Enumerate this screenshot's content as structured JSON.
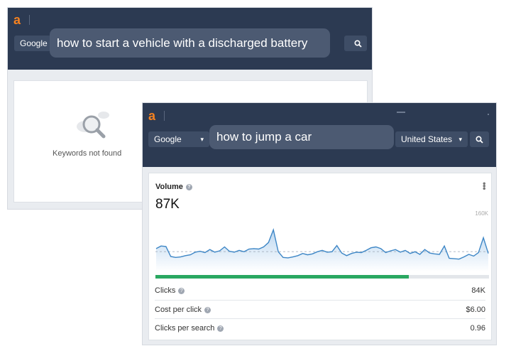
{
  "back_window": {
    "logo": "a",
    "engine": "Google",
    "query": "how to start a vehicle with a discharged battery",
    "empty_message": "Keywords not found"
  },
  "front_window": {
    "logo": "a",
    "engine": "Google",
    "query": "how to jump a car",
    "country": "United States",
    "volume_label": "Volume",
    "volume_value": "87K",
    "chart_max_label": "160K",
    "progress_fraction": 0.76,
    "metrics": [
      {
        "label": "Clicks",
        "value": "84K"
      },
      {
        "label": "Cost per click",
        "value": "$6.00"
      },
      {
        "label": "Clicks per search",
        "value": "0.96"
      }
    ]
  },
  "colors": {
    "topbar": "#2c3a52",
    "accent_orange": "#f58220",
    "line_blue": "#3d86c6",
    "progress_green": "#2aa861"
  },
  "chart_data": {
    "type": "area",
    "ylim": [
      0,
      160000
    ],
    "values": [
      92000,
      98000,
      97000,
      74000,
      72000,
      73000,
      76000,
      78000,
      84000,
      86000,
      83000,
      90000,
      84000,
      87000,
      96000,
      86000,
      84000,
      88000,
      85000,
      91000,
      92000,
      91000,
      96000,
      106000,
      135000,
      85000,
      72000,
      71000,
      73000,
      76000,
      81000,
      78000,
      80000,
      85000,
      88000,
      84000,
      85000,
      99000,
      82000,
      76000,
      81000,
      84000,
      83000,
      88000,
      94000,
      96000,
      92000,
      83000,
      87000,
      90000,
      84000,
      88000,
      81000,
      85000,
      79000,
      90000,
      82000,
      80000,
      79000,
      98000,
      70000,
      69000,
      68000,
      73000,
      79000,
      75000,
      83000,
      117000,
      81000
    ]
  }
}
